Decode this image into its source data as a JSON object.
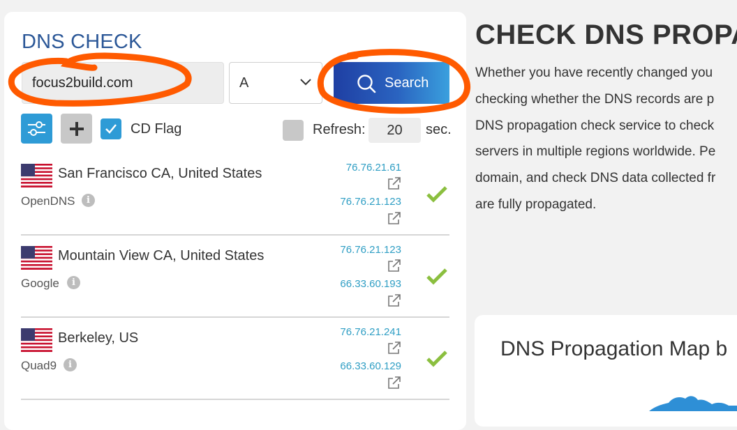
{
  "dns_check": {
    "title": "DNS CHECK",
    "domain_value": "focus2build.com",
    "record_type": "A",
    "search_label": "Search",
    "cd_flag_label": "CD Flag",
    "refresh_label": "Refresh:",
    "refresh_value": "20",
    "sec_label": "sec.",
    "cd_flag_checked": true,
    "refresh_checked": false
  },
  "results": [
    {
      "location": "San Francisco CA, United States",
      "provider": "OpenDNS",
      "ips": [
        "76.76.21.61",
        "76.76.21.123"
      ],
      "status": "ok"
    },
    {
      "location": "Mountain View CA, United States",
      "provider": "Google",
      "ips": [
        "76.76.21.123",
        "66.33.60.193"
      ],
      "status": "ok"
    },
    {
      "location": "Berkeley, US",
      "provider": "Quad9",
      "ips": [
        "76.76.21.241",
        "66.33.60.129"
      ],
      "status": "ok"
    }
  ],
  "article": {
    "heading": "CHECK DNS PROPAG",
    "lines": [
      "Whether you have recently changed you",
      "checking whether the DNS records are p",
      "DNS propagation check service to check",
      "servers in multiple regions worldwide. Pe",
      "domain, and check DNS data collected fr",
      "are fully propagated."
    ]
  },
  "map": {
    "title": "DNS Propagation Map b"
  },
  "colors": {
    "accent": "#2e9bd6",
    "title_blue": "#2b5797",
    "ip_link": "#2f9ec4",
    "check_green": "#8bbf3f",
    "annotation_orange": "#ff5a00"
  }
}
